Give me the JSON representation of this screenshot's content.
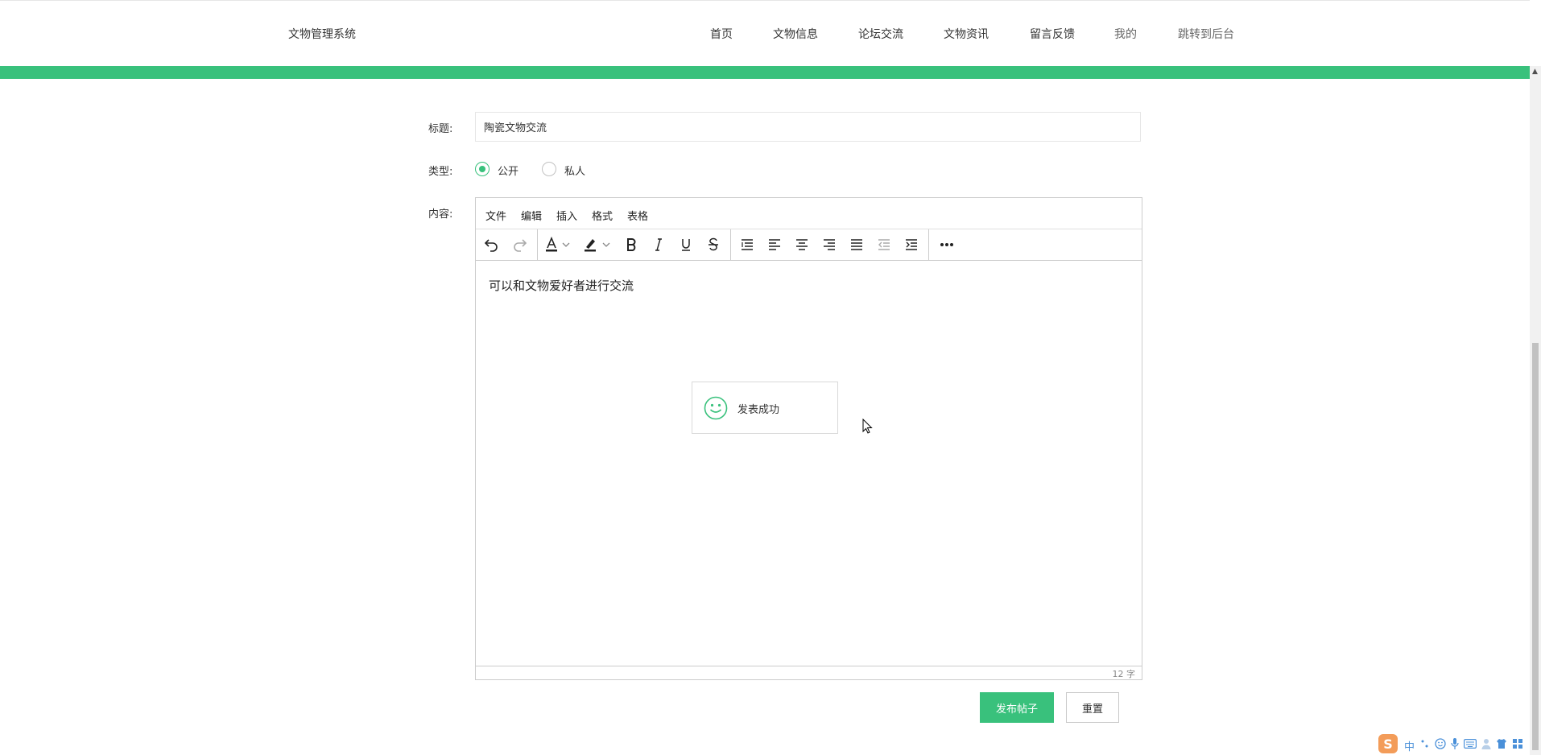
{
  "header": {
    "brand": "文物管理系统",
    "nav": [
      "首页",
      "文物信息",
      "论坛交流",
      "文物资讯",
      "留言反馈",
      "我的",
      "跳转到后台"
    ]
  },
  "form": {
    "title_label": "标题:",
    "title_value": "陶瓷文物交流",
    "type_label": "类型:",
    "type_options": [
      "公开",
      "私人"
    ],
    "type_selected": "公开",
    "content_label": "内容:"
  },
  "editor": {
    "menus": [
      "文件",
      "编辑",
      "插入",
      "格式",
      "表格"
    ],
    "toolbar_icons": [
      "undo-icon",
      "redo-icon",
      "text-color-icon",
      "highlight-color-icon",
      "bold-icon",
      "italic-icon",
      "underline-icon",
      "strikethrough-icon",
      "line-height-icon",
      "align-left-icon",
      "align-center-icon",
      "align-right-icon",
      "align-justify-icon",
      "outdent-icon",
      "indent-icon",
      "more-icon"
    ],
    "content": "可以和文物爱好者进行交流",
    "word_count": "12 字"
  },
  "toast": {
    "message": "发表成功",
    "icon": "smile-icon"
  },
  "buttons": {
    "submit": "发布帖子",
    "reset": "重置"
  },
  "ime": {
    "logo": "S",
    "lang": "中"
  },
  "colors": {
    "accent": "#39c17c"
  }
}
